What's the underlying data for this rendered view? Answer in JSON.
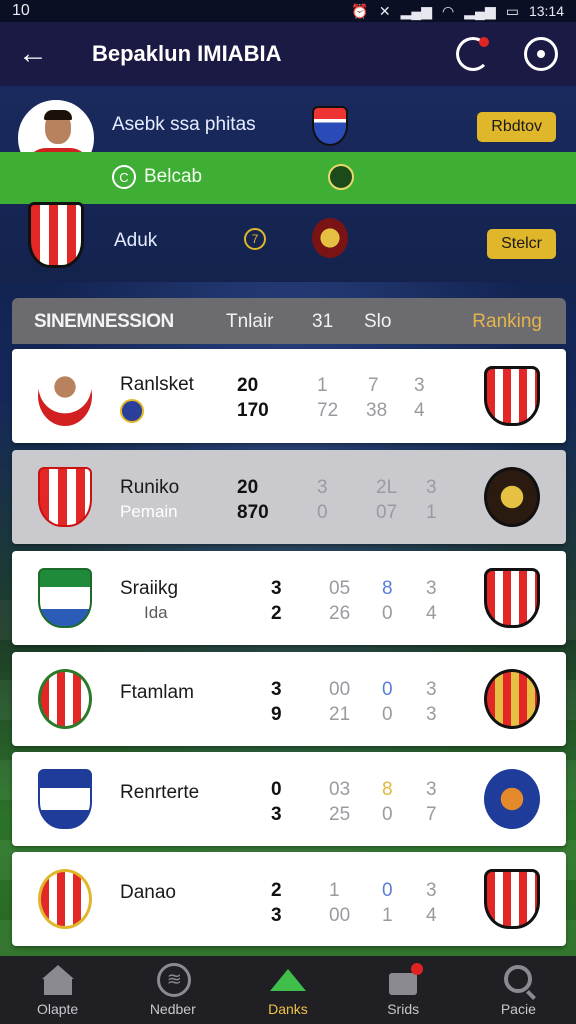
{
  "status_bar": {
    "left": "10",
    "time": "13:14"
  },
  "app_bar": {
    "back_icon": "arrow-left-icon",
    "title": "Bepaklun IMIABIA"
  },
  "top_panel": {
    "row1": {
      "text": "Asebk ssa phitas",
      "button": "Rbdtov"
    },
    "row2": {
      "text": "Belcab",
      "icon_text": "C"
    },
    "row3": {
      "text": "Aduk",
      "num": "7",
      "button": "Stelcr"
    }
  },
  "table_header": {
    "title": "SINEMNESSION",
    "col1": "Tnlair",
    "col2": "31",
    "col3": "Slo",
    "ranking": "Ranking"
  },
  "rows": [
    {
      "name": "Ranlsket",
      "sub": "",
      "v1": "20",
      "v2": "170",
      "a1": "1",
      "a2": "72",
      "b1": "7",
      "b2": "38",
      "c1": "3",
      "c2": "4"
    },
    {
      "name": "Runiko",
      "sub": "Pemain",
      "v1": "20",
      "v2": "870",
      "a1": "3",
      "a2": "0",
      "b1": "2L",
      "b2": "07",
      "c1": "3",
      "c2": "1"
    },
    {
      "name": "Sraiikg",
      "sub": "Ida",
      "v1": "3",
      "v2": "2",
      "a1": "05",
      "a2": "26",
      "b1": "8",
      "b2": "0",
      "c1": "3",
      "c2": "4"
    },
    {
      "name": "Ftamlam",
      "sub": "",
      "v1": "3",
      "v2": "9",
      "a1": "00",
      "a2": "21",
      "b1": "0",
      "b2": "0",
      "c1": "3",
      "c2": "3"
    },
    {
      "name": "Renrterte",
      "sub": "",
      "v1": "0",
      "v2": "3",
      "a1": "03",
      "a2": "25",
      "b1": "8",
      "b2": "0",
      "c1": "3",
      "c2": "7"
    },
    {
      "name": "Danao",
      "sub": "",
      "v1": "2",
      "v2": "3",
      "a1": "1",
      "a2": "00",
      "b1": "0",
      "b2": "1",
      "c1": "3",
      "c2": "4"
    }
  ],
  "bottom_nav": [
    {
      "label": "Olapte",
      "icon": "home-icon"
    },
    {
      "label": "Nedber",
      "icon": "ball-icon"
    },
    {
      "label": "Danks",
      "icon": "shoe-icon"
    },
    {
      "label": "Srids",
      "icon": "bag-icon"
    },
    {
      "label": "Pacie",
      "icon": "search-icon"
    }
  ],
  "colors": {
    "accent_gold": "#e0b72a",
    "accent_green": "#3fae35",
    "app_bar": "#1b1a44"
  }
}
